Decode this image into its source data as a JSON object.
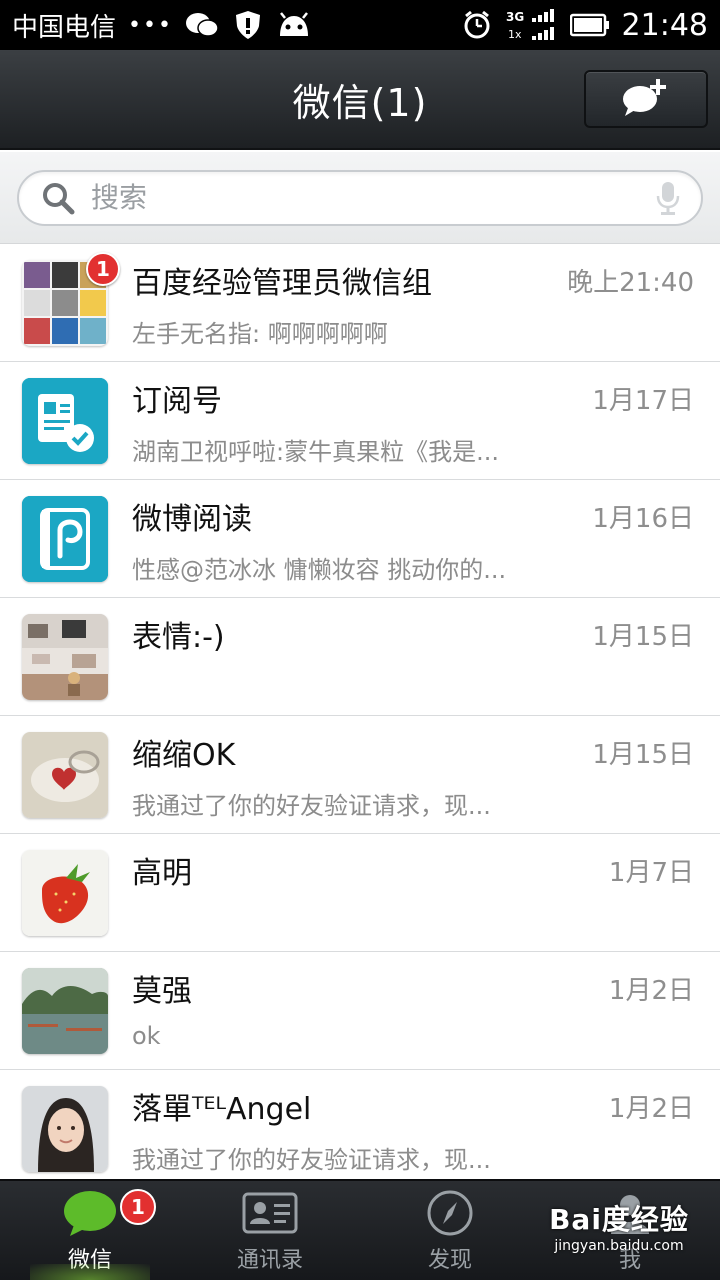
{
  "status_bar": {
    "carrier": "中国电信",
    "dots": "•••",
    "network": "3G",
    "time": "21:48"
  },
  "header": {
    "title": "微信(1)",
    "compose_icon": "chat-add-icon"
  },
  "search": {
    "placeholder": "搜索",
    "value": ""
  },
  "chats": [
    {
      "name": "百度经验管理员微信组",
      "time": "晚上21:40",
      "preview": "左手无名指: 啊啊啊啊啊",
      "unread": "1",
      "avatar": "group-grid"
    },
    {
      "name": "订阅号",
      "time": "1月17日",
      "preview": "湖南卫视呼啦:蒙牛真果粒《我是...",
      "unread": "",
      "avatar": "subscription"
    },
    {
      "name": "微博阅读",
      "time": "1月16日",
      "preview": "性感@范冰冰 慵懒妆容 挑动你的...",
      "unread": "",
      "avatar": "weibo-reader"
    },
    {
      "name": "表情:-)",
      "time": "1月15日",
      "preview": "",
      "unread": "",
      "avatar": "photo-room"
    },
    {
      "name": "缩缩OK",
      "time": "1月15日",
      "preview": "我通过了你的好友验证请求，现...",
      "unread": "",
      "avatar": "heart-dish"
    },
    {
      "name": "高明",
      "time": "1月7日",
      "preview": "",
      "unread": "",
      "avatar": "strawberry"
    },
    {
      "name": "莫强",
      "time": "1月2日",
      "preview": "ok",
      "unread": "",
      "avatar": "lake"
    },
    {
      "name": "落單ᵀᴱᴸAngel",
      "time": "1月2日",
      "preview": "我通过了你的好友验证请求，现...",
      "unread": "",
      "avatar": "portrait"
    }
  ],
  "tabs": [
    {
      "label": "微信",
      "icon": "chat-bubble-icon",
      "badge": "1",
      "active": true
    },
    {
      "label": "通讯录",
      "icon": "contacts-card-icon",
      "badge": "",
      "active": false
    },
    {
      "label": "发现",
      "icon": "compass-icon",
      "badge": "",
      "active": false
    },
    {
      "label": "我",
      "icon": "profile-icon",
      "badge": "",
      "active": false
    }
  ],
  "watermark": {
    "logo": "Bai度经验",
    "url": "jingyan.baidu.com"
  },
  "colors": {
    "badge_red": "#e23030",
    "accent_green": "#5dbb2a",
    "teal": "#1aa3c0"
  }
}
